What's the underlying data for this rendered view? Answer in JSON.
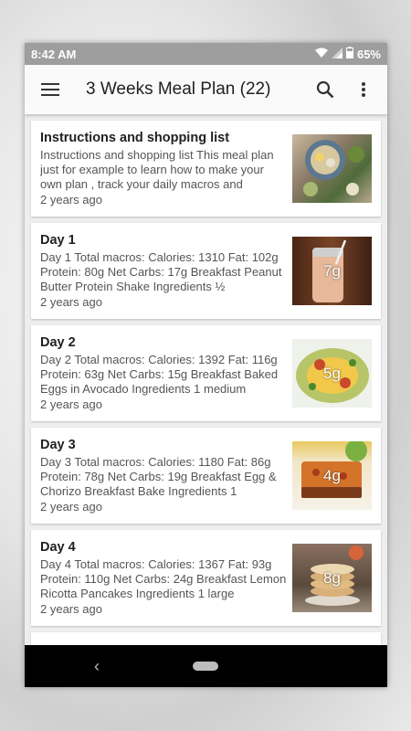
{
  "status": {
    "time": "8:42 AM",
    "battery": "65%"
  },
  "app_bar": {
    "title": "3 Weeks Meal Plan (22)",
    "menu_icon": "menu-icon",
    "search_icon": "search-icon",
    "more_icon": "more-vert-icon"
  },
  "items": [
    {
      "title": "Instructions and shopping list",
      "desc": "Instructions and shopping list This meal plan just for example to learn how to make your own plan , track your daily macros and",
      "time": "2 years ago",
      "net_carbs": "",
      "thumb_color": "#8a7a66"
    },
    {
      "title": "Day 1",
      "desc": "Day 1 Total macros:  Calories: 1310 Fat: 102g Protein: 80g Net Carbs: 17g  Breakfast Peanut Butter Protein Shake Ingredients ½",
      "time": "2 years ago",
      "net_carbs": "7g",
      "thumb_color": "#6b3a22"
    },
    {
      "title": "Day 2",
      "desc": "Day 2 Total macros:  Calories: 1392 Fat: 116g Protein: 63g Net Carbs: 15g  Breakfast Baked Eggs in Avocado Ingredients 1 medium",
      "time": "2 years ago",
      "net_carbs": "5g",
      "thumb_color": "#7a9a3a"
    },
    {
      "title": "Day 3",
      "desc": "Day 3 Total macros:  Calories: 1180 Fat: 86g Protein: 78g Net Carbs: 19g  Breakfast Egg & Chorizo Breakfast Bake Ingredients 1",
      "time": "2 years ago",
      "net_carbs": "4g",
      "thumb_color": "#c86a2a"
    },
    {
      "title": "Day 4",
      "desc": "Day 4 Total macros:  Calories: 1367 Fat: 93g Protein: 110g Net Carbs: 24g  Breakfast Lemon Ricotta Pancakes Ingredients 1 large",
      "time": "2 years ago",
      "net_carbs": "8g",
      "thumb_color": "#7a6452"
    }
  ],
  "nav": {
    "back_icon": "back-icon",
    "home_icon": "home-pill-icon"
  }
}
